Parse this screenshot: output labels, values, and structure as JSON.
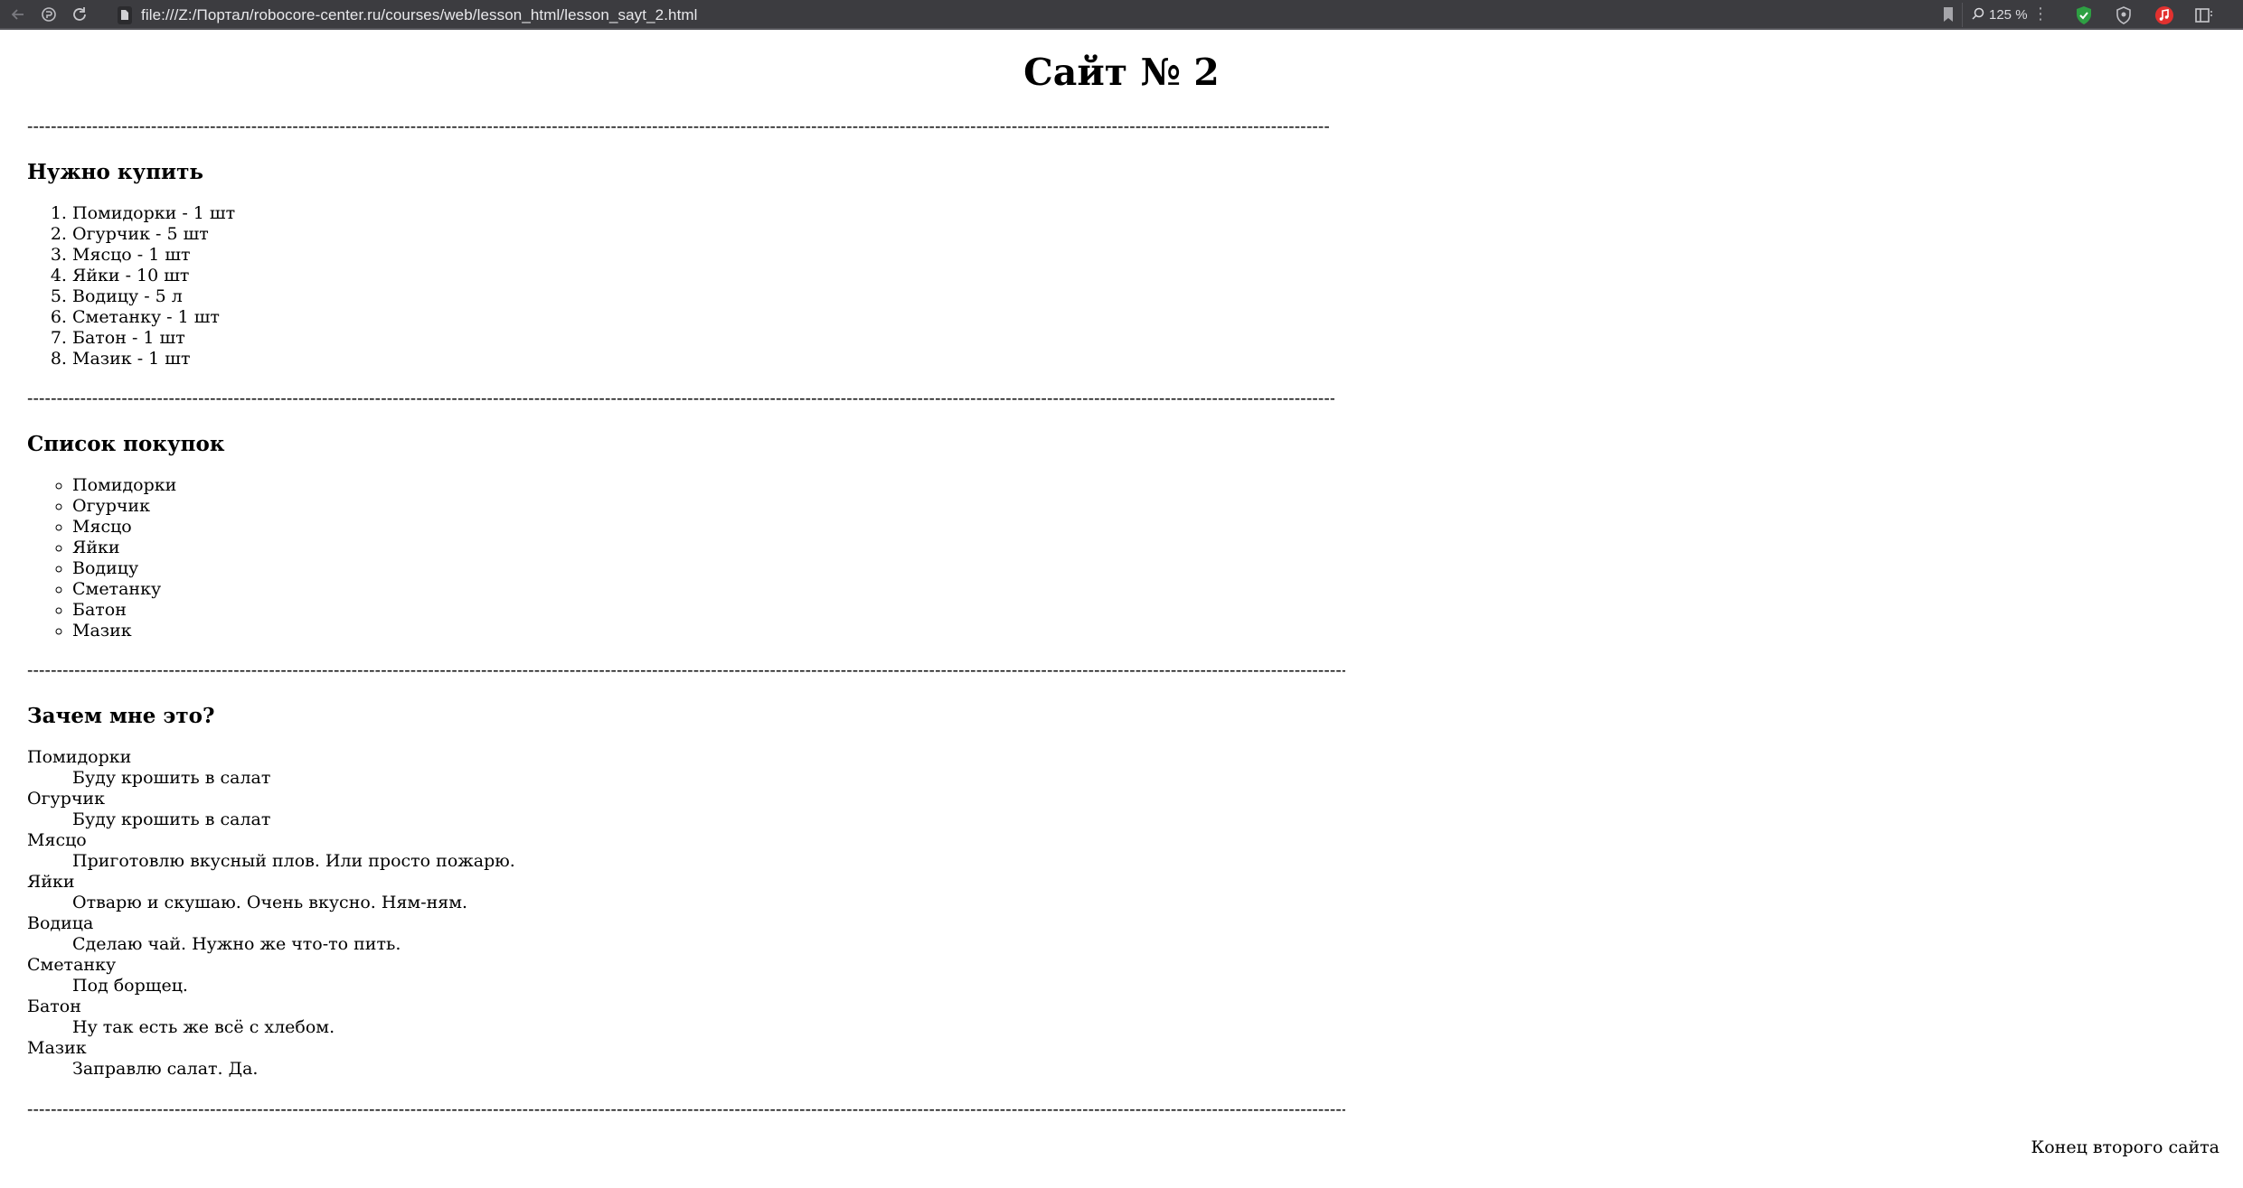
{
  "browser": {
    "url": "file:///Z:/Портал/robocore-center.ru/courses/web/lesson_html/lesson_sayt_2.html",
    "zoom_label": "125 %",
    "extensions": [
      "shield-check-icon",
      "shield-icon",
      "music-icon",
      "sidebar-icon"
    ]
  },
  "page": {
    "title": "Сайт № 2",
    "separator": "----------------------------------------------------------------------------------------------------------------------------------------------------------------------------------------------------------------------------------",
    "buy": {
      "heading": "Нужно купить",
      "items": [
        "Помидорки - 1 шт",
        "Огурчик - 5 шт",
        "Мясцо - 1 шт",
        "Яйки - 10 шт",
        "Водицу - 5 л",
        "Сметанку - 1 шт",
        "Батон - 1 шт",
        "Мазик - 1 шт"
      ]
    },
    "shopping": {
      "heading": "Список покупок",
      "items": [
        "Помидорки",
        "Огурчик",
        "Мясцо",
        "Яйки",
        "Водицу",
        "Сметанку",
        "Батон",
        "Мазик"
      ]
    },
    "why": {
      "heading": "Зачем мне это?",
      "entries": [
        {
          "term": "Помидорки",
          "desc": "Буду крошить в салат"
        },
        {
          "term": "Огурчик",
          "desc": "Буду крошить в салат"
        },
        {
          "term": "Мясцо",
          "desc": "Приготовлю вкусный плов. Или просто пожарю."
        },
        {
          "term": "Яйки",
          "desc": "Отварю и скушаю. Очень вкусно. Ням-ням."
        },
        {
          "term": "Водица",
          "desc": "Сделаю чай. Нужно же что-то пить."
        },
        {
          "term": "Сметанку",
          "desc": "Под борщец."
        },
        {
          "term": "Батон",
          "desc": "Ну так есть же всё с хлебом."
        },
        {
          "term": "Мазик",
          "desc": "Заправлю салат. Да."
        }
      ]
    },
    "footer": "Конец второго сайта"
  }
}
